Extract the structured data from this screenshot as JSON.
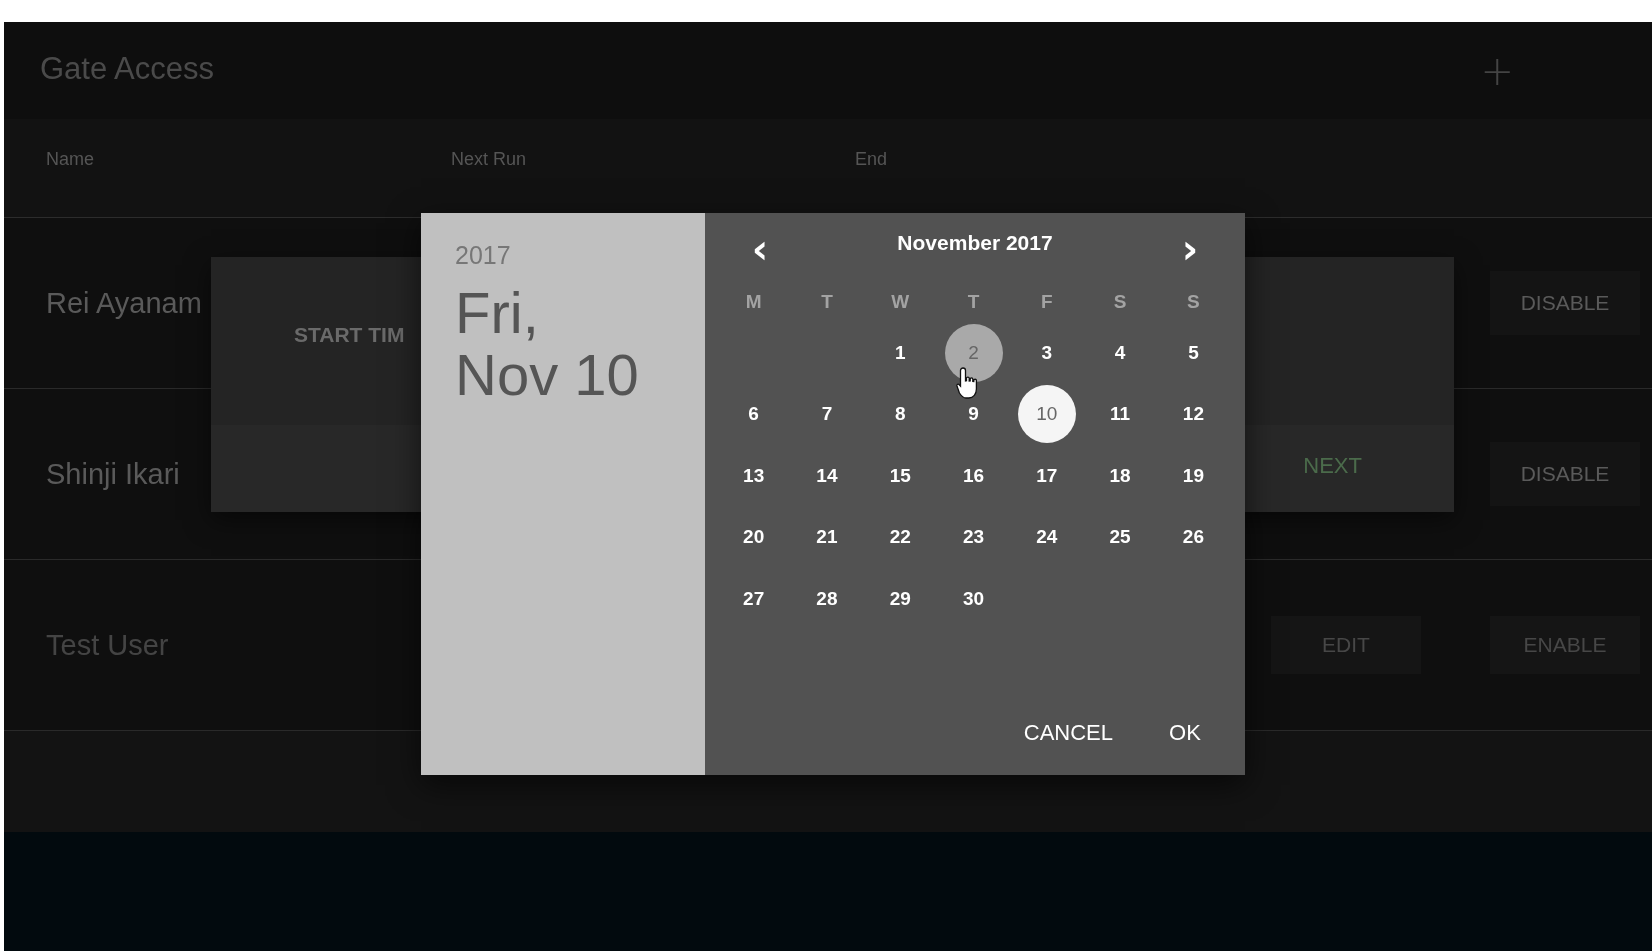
{
  "app_bar": {
    "title": "Gate Access",
    "add_button": "+"
  },
  "table": {
    "columns": [
      "Name",
      "Next Run",
      "End"
    ],
    "rows": [
      {
        "name": "Rei Ayanam",
        "enabled": true,
        "actions": [
          "DISABLE"
        ]
      },
      {
        "name": "Shinji Ikari",
        "enabled": true,
        "actions": [
          "DISABLE"
        ]
      },
      {
        "name": "Test User",
        "enabled": false,
        "actions": [
          "EDIT",
          "ENABLE"
        ]
      }
    ]
  },
  "stepper_dialog": {
    "step_label": "START TIM",
    "next_button": "NEXT"
  },
  "date_picker": {
    "year": "2017",
    "date_line_1": "Fri,",
    "date_line_2": "Nov 10",
    "month": "November 2017",
    "prev_button": "‹",
    "next_button": "›",
    "weekdays": [
      "M",
      "T",
      "W",
      "T",
      "F",
      "S",
      "S"
    ],
    "weeks": [
      {
        "starts_mid_week": true,
        "days": [
          {
            "day": "1",
            "selected": false,
            "hovered": false
          },
          {
            "day": "2",
            "selected": false,
            "hovered": true
          },
          {
            "day": "3",
            "selected": false,
            "hovered": false
          },
          {
            "day": "4",
            "selected": false,
            "hovered": false
          },
          {
            "day": "5",
            "selected": false,
            "hovered": false
          }
        ]
      },
      {
        "days": [
          {
            "day": "6",
            "selected": false,
            "hovered": false
          },
          {
            "day": "7",
            "selected": false,
            "hovered": false
          },
          {
            "day": "8",
            "selected": false,
            "hovered": false
          },
          {
            "day": "9",
            "selected": false,
            "hovered": false
          },
          {
            "day": "10",
            "selected": true,
            "hovered": false
          },
          {
            "day": "11",
            "selected": false,
            "hovered": false
          },
          {
            "day": "12",
            "selected": false,
            "hovered": false
          }
        ]
      },
      {
        "days": [
          {
            "day": "13",
            "selected": false,
            "hovered": false
          },
          {
            "day": "14",
            "selected": false,
            "hovered": false
          },
          {
            "day": "15",
            "selected": false,
            "hovered": false
          },
          {
            "day": "16",
            "selected": false,
            "hovered": false
          },
          {
            "day": "17",
            "selected": false,
            "hovered": false
          },
          {
            "day": "18",
            "selected": false,
            "hovered": false
          },
          {
            "day": "19",
            "selected": false,
            "hovered": false
          }
        ]
      },
      {
        "days": [
          {
            "day": "20",
            "selected": false,
            "hovered": false
          },
          {
            "day": "21",
            "selected": false,
            "hovered": false
          },
          {
            "day": "22",
            "selected": false,
            "hovered": false
          },
          {
            "day": "23",
            "selected": false,
            "hovered": false
          },
          {
            "day": "24",
            "selected": false,
            "hovered": false
          },
          {
            "day": "25",
            "selected": false,
            "hovered": false
          },
          {
            "day": "26",
            "selected": false,
            "hovered": false
          }
        ]
      },
      {
        "starts_mid_week": false,
        "days": [
          {
            "day": "27",
            "selected": false,
            "hovered": false
          },
          {
            "day": "28",
            "selected": false,
            "hovered": false
          },
          {
            "day": "29",
            "selected": false,
            "hovered": false
          },
          {
            "day": "30",
            "selected": false,
            "hovered": false
          }
        ]
      }
    ],
    "actions": [
      "CANCEL",
      "OK"
    ]
  }
}
